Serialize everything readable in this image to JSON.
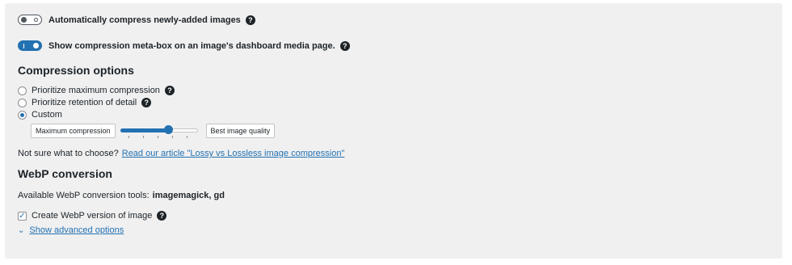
{
  "settings": {
    "auto_compress": {
      "label": "Automatically compress newly-added images",
      "help": "?"
    },
    "meta_box": {
      "label": "Show compression meta-box on an image's dashboard media page.",
      "help": "?"
    }
  },
  "compression": {
    "heading": "Compression options",
    "options": [
      {
        "label": "Prioritize maximum compression",
        "help": "?",
        "checked": false
      },
      {
        "label": "Prioritize retention of detail",
        "help": "?",
        "checked": false
      },
      {
        "label": "Custom",
        "checked": true
      }
    ],
    "slider": {
      "left_label": "Maximum compression",
      "right_label": "Best image quality",
      "value_fraction": 0.62
    },
    "note_prefix": "Not sure what to choose?",
    "note_link": "Read our article \"Lossy vs Lossless image compression\""
  },
  "webp": {
    "heading": "WebP conversion",
    "tools_prefix": "Available WebP conversion tools:",
    "tools_value": "imagemagick, gd",
    "create_label": "Create WebP version of image",
    "create_help": "?",
    "create_checked": true,
    "advanced_label": "Show advanced options"
  },
  "colors": {
    "accent": "#2271b1",
    "panel_bg": "#f0f0f1"
  },
  "icons": {
    "help": "question-circle-icon",
    "checkbox": "checkmark-icon",
    "advanced": "chevron-down-icon"
  }
}
